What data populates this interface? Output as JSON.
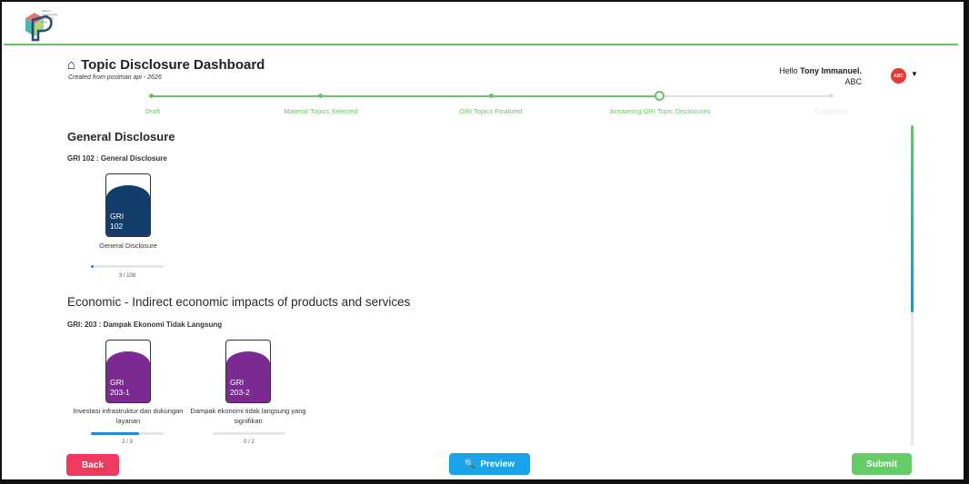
{
  "logo": {
    "lines": [
      "Making",
      "Sustainability",
      "Reporting",
      "Easy"
    ]
  },
  "header": {
    "title": "Topic Disclosure Dashboard",
    "subtitle": "Created from postman api - 2626",
    "greeting": "Hello",
    "user_name": "Tony Immanuel.",
    "org": "ABC",
    "avatar_text": "ABC"
  },
  "stepper": {
    "steps": [
      {
        "label": "Draft",
        "state": "done"
      },
      {
        "label": "Material Topics Selected",
        "state": "done"
      },
      {
        "label": "GRI Topics Finalized",
        "state": "done"
      },
      {
        "label": "Answering GRI Topic Disclosures",
        "state": "current"
      },
      {
        "label": "Completed",
        "state": "todo"
      }
    ]
  },
  "sections": [
    {
      "title": "General Disclosure",
      "subtitle": "GRI 102 : General Disclosure",
      "color": "#123d6b",
      "cards": [
        {
          "code_line1": "GRI",
          "code_line2": "102",
          "label": "General Disclosure",
          "progress": 0.028,
          "count": "3 / 108"
        }
      ]
    },
    {
      "title": "Economic - Indirect economic impacts of products and services",
      "subtitle": "GRI: 203 : Dampak Ekonomi Tidak Langsung",
      "color": "#7a2a91",
      "cards": [
        {
          "code_line1": "GRI",
          "code_line2": "203-1",
          "label": "Investasi infrastruktur dan dukungan layanan",
          "progress": 0.667,
          "count": "2 / 3"
        },
        {
          "code_line1": "GRI",
          "code_line2": "203-2",
          "label": "Dampak ekonomi tidak langsung yang signifikan",
          "progress": 0.0,
          "count": "0 / 2"
        }
      ]
    }
  ],
  "buttons": {
    "back": "Back",
    "preview": "Preview",
    "submit": "Submit"
  },
  "colors": {
    "accent_green": "#6cc26a",
    "back": "#f0395e",
    "preview": "#1aa3e8",
    "submit": "#66cc6a"
  }
}
